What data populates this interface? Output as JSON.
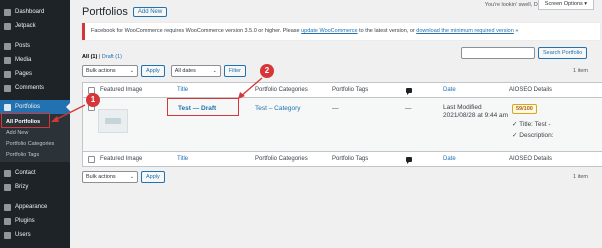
{
  "sidebar": {
    "items": [
      {
        "label": "Dashboard",
        "icon": "dashboard-icon"
      },
      {
        "label": "Jetpack",
        "icon": "jetpack-icon"
      },
      {
        "label": "Posts",
        "icon": "pin-icon"
      },
      {
        "label": "Media",
        "icon": "media-icon"
      },
      {
        "label": "Pages",
        "icon": "page-icon"
      },
      {
        "label": "Comments",
        "icon": "comment-icon"
      },
      {
        "label": "Portfolios",
        "icon": "portfolio-icon"
      },
      {
        "label": "Contact",
        "icon": "contact-icon"
      },
      {
        "label": "Brizy",
        "icon": "brizy-icon"
      },
      {
        "label": "Appearance",
        "icon": "appearance-icon"
      },
      {
        "label": "Plugins",
        "icon": "plugin-icon"
      },
      {
        "label": "Users",
        "icon": "users-icon"
      }
    ],
    "submenu": [
      "All Portfolios",
      "Add New",
      "Portfolio Categories",
      "Portfolio Tags"
    ]
  },
  "topbar": {
    "howdy": "You're lookin' swell, Dolly",
    "screen_options": "Screen Options ▾"
  },
  "header": {
    "title": "Portfolios",
    "add_new": "Add New"
  },
  "notice": {
    "text_before": "Facebook for WooCommerce requires WooCommerce version 3.5.0 or higher. Please",
    "link1": "update WooCommerce",
    "text_middle": "to the latest version, or",
    "link2": "download the minimum required version",
    "arrow": "»"
  },
  "filters": {
    "all": "All",
    "all_count": "(1)",
    "sep": "|",
    "draft": "Draft",
    "draft_count": "(1)",
    "search_button": "Search Portfolio"
  },
  "tablenav_top": {
    "bulk_actions": "Bulk actions",
    "apply": "Apply",
    "dates": "All dates",
    "filter": "Filter",
    "items": "1 item"
  },
  "tablenav_bottom": {
    "bulk_actions": "Bulk actions",
    "apply": "Apply",
    "items": "1 item"
  },
  "table": {
    "columns": {
      "featured_image": "Featured Image",
      "title": "Title",
      "categories": "Portfolio Categories",
      "tags": "Portfolio Tags",
      "date": "Date",
      "aioseo": "AIOSEO Details"
    },
    "row": {
      "title": "Test — Draft",
      "category": "Test – Category",
      "tags": "—",
      "comments": "—",
      "date_status": "Last Modified",
      "date": "2021/08/28 at 9:44 am",
      "seo_score": "59/100",
      "seo_title": "Title: Test -",
      "seo_description": "Description:"
    }
  },
  "annotations": {
    "marker1": "1",
    "marker2": "2",
    "color": "#d63638"
  },
  "colors": {
    "sidebar": "#1d2327",
    "accent": "#2271b1",
    "error": "#d63638"
  }
}
